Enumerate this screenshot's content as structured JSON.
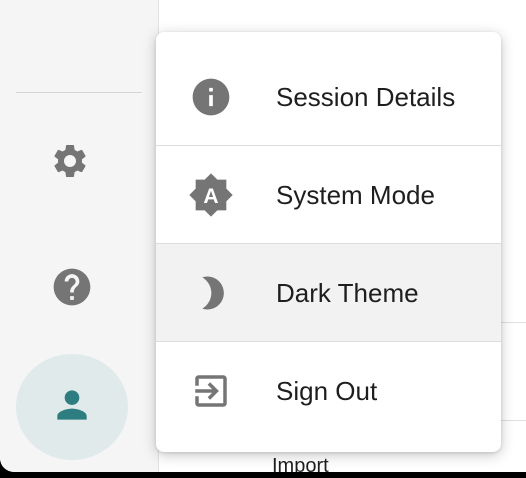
{
  "menu": {
    "items": [
      {
        "label": "Session Details",
        "icon": "info-icon"
      },
      {
        "label": "System Mode",
        "icon": "brightness-auto-icon"
      },
      {
        "label": "Dark Theme",
        "icon": "moon-icon"
      },
      {
        "label": "Sign Out",
        "icon": "logout-icon"
      }
    ]
  },
  "sidebar": {
    "settings_icon": "gear-icon",
    "help_icon": "help-icon",
    "account_icon": "person-icon"
  },
  "main": {
    "import_label": "Import"
  },
  "colors": {
    "icon_gray": "#757575",
    "accent_teal": "#2e7d80",
    "account_bg": "#e0eaea",
    "hover_bg": "#f2f2f2"
  }
}
